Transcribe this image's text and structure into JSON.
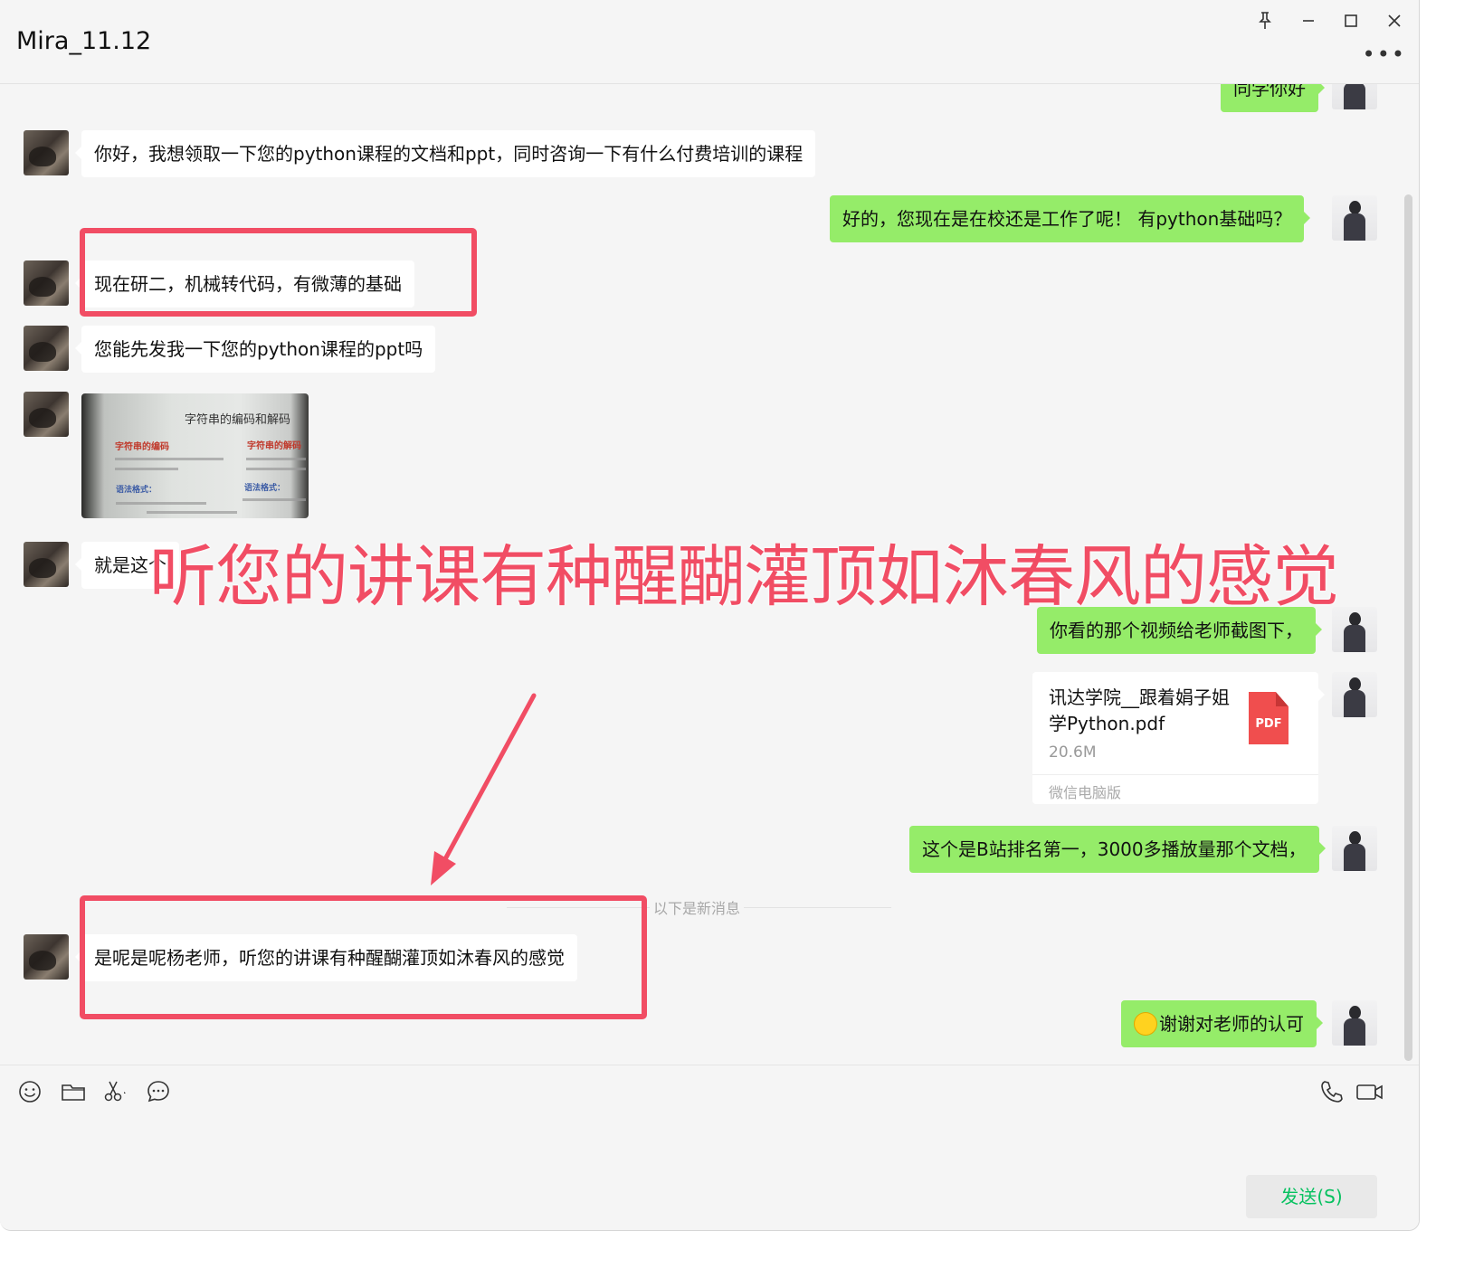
{
  "window": {
    "title": "Mira_11.12",
    "icons": [
      "pin-icon",
      "minimize-icon",
      "maximize-icon",
      "close-icon",
      "more-icon"
    ]
  },
  "messages": {
    "m0": "同学你好",
    "m1": "你好，我想领取一下您的python课程的文档和ppt，同时咨询一下有什么付费培训的课程",
    "m2": "好的，您现在是在校还是工作了呢！   有python基础吗？",
    "m3": "现在研二，机械转代码，有微薄的基础",
    "m4": "您能先发我一下您的python课程的ppt吗",
    "m5": "就是这个",
    "m6": "你看的那个视频给老师截图下，",
    "m7": "这个是B站排名第一，3000多播放量那个文档，",
    "m8": "是呢是呢杨老师，听您的讲课有种醒醐灌顶如沐春风的感觉",
    "m9": "谢谢对老师的认可"
  },
  "image_msg": {
    "title": "字符串的编码和解码",
    "left_heading": "字符串的编码",
    "right_heading": "字符串的解码",
    "left_syntax": "语法格式：",
    "right_syntax": "语法格式："
  },
  "file_msg": {
    "name": "讯达学院__跟着娟子姐学Python.pdf",
    "size": "20.6M",
    "source": "微信电脑版",
    "type_label": "PDF"
  },
  "divider": {
    "new_messages": "以下是新消息"
  },
  "overlay": {
    "caption": "听您的讲课有种醒醐灌顶如沐春风的感觉",
    "color": "#f14d64"
  },
  "toolbar": {
    "icons": [
      "emoji-icon",
      "folder-icon",
      "scissors-icon",
      "chat-history-icon",
      "phone-icon",
      "video-icon"
    ],
    "send_label": "发送(S)"
  },
  "colors": {
    "outgoing_bubble": "#95ec69",
    "incoming_bubble": "#ffffff",
    "send_text": "#07c160",
    "background": "#f5f5f5"
  }
}
